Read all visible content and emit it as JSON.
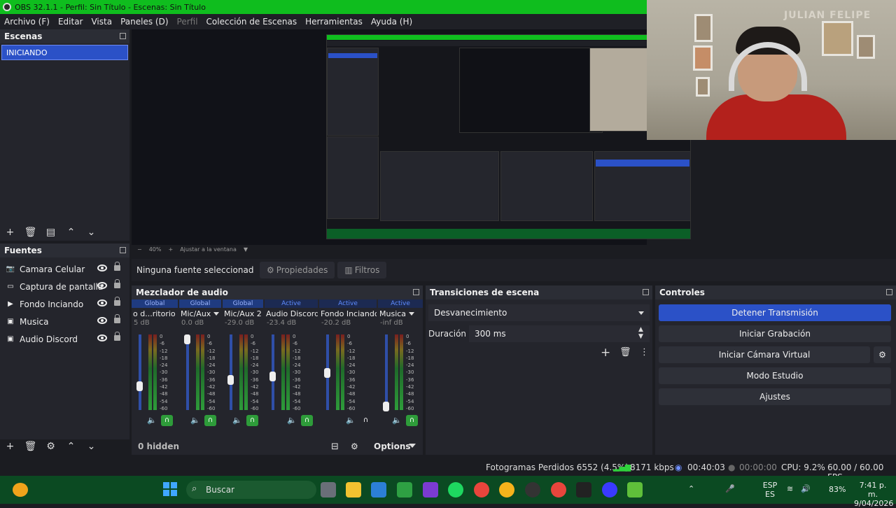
{
  "window": {
    "title": "OBS 32.1.1 - Perfil: Sin Título - Escenas: Sin Título"
  },
  "menu": [
    "Archivo (F)",
    "Editar",
    "Vista",
    "Paneles (D)",
    "Perfil",
    "Colección de Escenas",
    "Herramientas",
    "Ayuda (H)"
  ],
  "scenes": {
    "title": "Escenas",
    "items": [
      "INICIANDO"
    ]
  },
  "preview": {
    "zoom": "40%",
    "fit_label": "Ajustar a la ventana",
    "webcam_banner": "JULIAN FELIPE"
  },
  "sources_bar": {
    "none_selected": "Ninguna fuente seleccionad",
    "properties": "Propiedades",
    "filters": "Filtros"
  },
  "sources": {
    "title": "Fuentes",
    "items": [
      {
        "label": "Camara Celular",
        "icon": "camera-icon"
      },
      {
        "label": "Captura de pantalla",
        "icon": "monitor-icon"
      },
      {
        "label": "Fondo Inciando",
        "icon": "play-icon"
      },
      {
        "label": "Musica",
        "icon": "media-icon"
      },
      {
        "label": "Audio Discord",
        "icon": "media-icon"
      }
    ]
  },
  "mixer": {
    "title": "Mezclador de audio",
    "channels": [
      {
        "head": "Global",
        "name": "o d...ritorio",
        "db": "5 dB",
        "level": 0.3
      },
      {
        "head": "Global",
        "name": "Mic/Aux",
        "db": "0.0 dB",
        "level": 1.0
      },
      {
        "head": "Global",
        "name": "Mic/Aux 2",
        "db": "-29.0 dB",
        "level": 0.4
      },
      {
        "head": "Active",
        "name": "Audio Discord",
        "db": "-23.4 dB",
        "level": 0.45
      },
      {
        "head": "Active",
        "name": "Fondo Inciando",
        "db": "-20.2 dB",
        "level": 0.5
      },
      {
        "head": "Active",
        "name": "Musica",
        "db": "-inf dB",
        "level": 0.0
      }
    ],
    "scale": [
      "0",
      "-6",
      "-12",
      "-18",
      "-24",
      "-30",
      "-36",
      "-42",
      "-48",
      "-54",
      "-60"
    ],
    "hidden": "0 hidden",
    "options": "Options"
  },
  "transitions": {
    "title": "Transiciones de escena",
    "type": "Desvanecimiento",
    "duration_label": "Duración",
    "duration_value": "300 ms"
  },
  "controls": {
    "title": "Controles",
    "buttons": [
      "Detener Transmisión",
      "Iniciar Grabación",
      "Iniciar Cámara Virtual",
      "Modo Estudio",
      "Ajustes"
    ]
  },
  "status": {
    "dropped": "Fotogramas Perdidos 6552 (4.5%)",
    "bitrate": "8171 kbps",
    "stream_time": "00:40:03",
    "rec_time": "00:00:00",
    "cpu": "CPU: 9.2%",
    "fps": "60.00 / 60.00 FPS"
  },
  "taskbar": {
    "search": "Buscar",
    "lang1": "ESP",
    "lang2": "ES",
    "battery": "83%",
    "time": "7:41 p. m.",
    "date": "9/04/2026"
  },
  "colors": {
    "accent": "#2b51c7",
    "titlebar": "#0fbd1e",
    "taskbar": "#0b4a22"
  }
}
